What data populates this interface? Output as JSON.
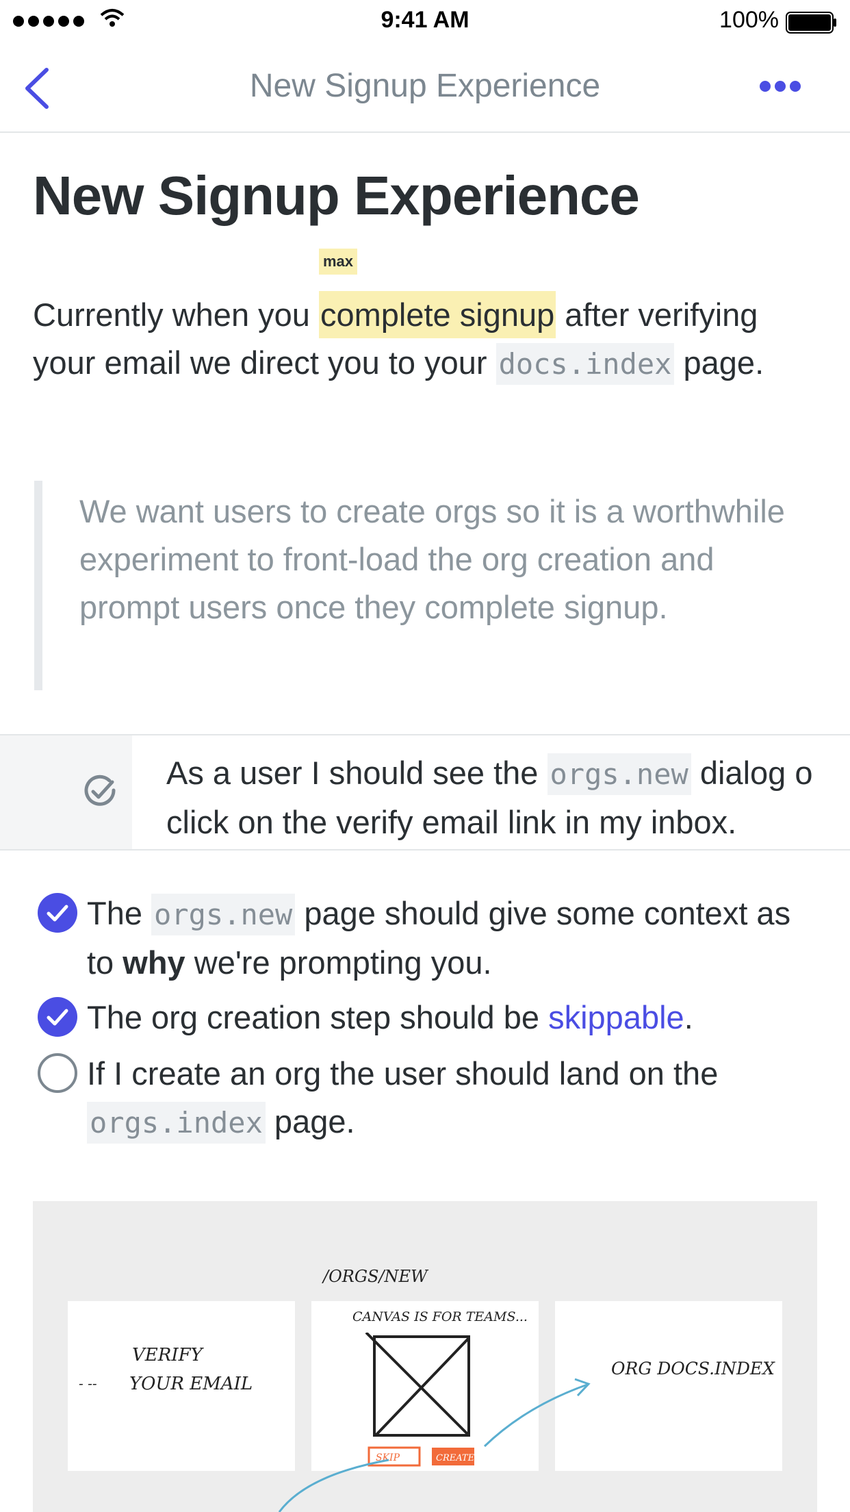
{
  "status_bar": {
    "time": "9:41 AM",
    "battery_pct": "100%"
  },
  "nav": {
    "title": "New Signup Experience",
    "back_icon": "chevron-left-icon",
    "more_icon": "ellipsis-icon"
  },
  "doc": {
    "title": "New Signup Experience",
    "para": {
      "pre": "Currently when you ",
      "highlight": "complete signup",
      "highlight_tag": "max",
      "mid": " after verifying your email we direct you to your ",
      "code": "docs.index",
      "post": " page."
    },
    "quote": "We want users to create orgs so it is a worthwhile experiment to front-load the org creation and prompt users once they complete signup.",
    "story": {
      "line1_pre": "As a user I should see the ",
      "line1_code": "orgs.new",
      "line1_post": " dialog o",
      "line2": "click on the verify email link in my inbox."
    },
    "todos": [
      {
        "checked": true,
        "pre": "The ",
        "code": "orgs.new",
        "mid": " page should give some context as to ",
        "bold": "why",
        "post": " we're prompting you."
      },
      {
        "checked": true,
        "pre": "The org creation step should be ",
        "link": "skippable",
        "post": "."
      },
      {
        "checked": false,
        "pre": "If I create an org the user should land on the ",
        "code": "orgs.index",
        "post": " page."
      }
    ],
    "sketch": {
      "route_label": "/ORGS/NEW",
      "panel1": [
        "VERIFY",
        "YOUR EMAIL"
      ],
      "panel1_arrow": "- --",
      "panel2_caption": "CANVAS IS FOR TEAMS...",
      "skip": "SKIP",
      "create": "CREATE",
      "panel3": "ORG DOCS.INDEX"
    },
    "colors": {
      "accent": "#4a4de3",
      "highlight": "#faf0b3",
      "sketch_orange": "#f26b3a",
      "sketch_blue": "#5aaed0"
    }
  }
}
